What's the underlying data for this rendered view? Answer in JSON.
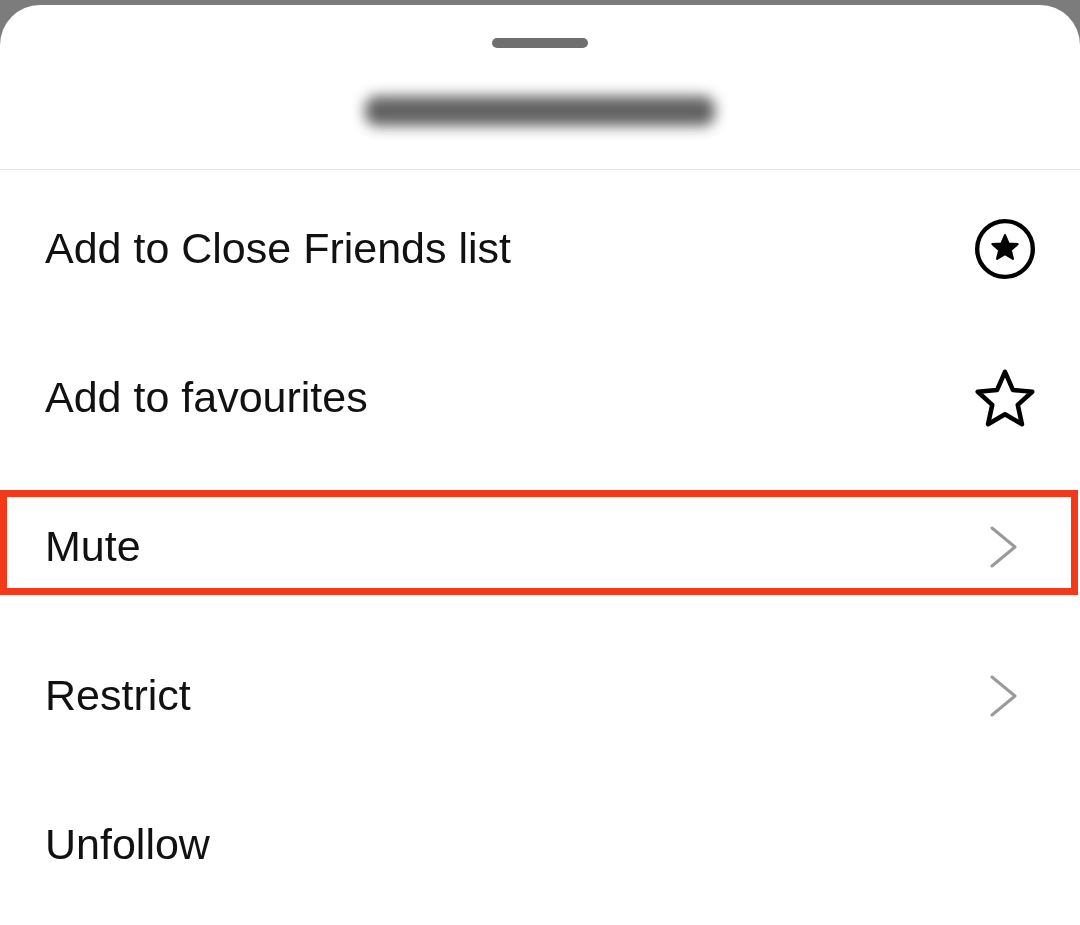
{
  "sheet": {
    "items": [
      {
        "label": "Add to Close Friends list",
        "kind": "circlestar",
        "highlighted": false
      },
      {
        "label": "Add to favourites",
        "kind": "star",
        "highlighted": false
      },
      {
        "label": "Mute",
        "kind": "chevron",
        "highlighted": true
      },
      {
        "label": "Restrict",
        "kind": "chevron",
        "highlighted": false
      },
      {
        "label": "Unfollow",
        "kind": "plain",
        "highlighted": false
      }
    ]
  }
}
